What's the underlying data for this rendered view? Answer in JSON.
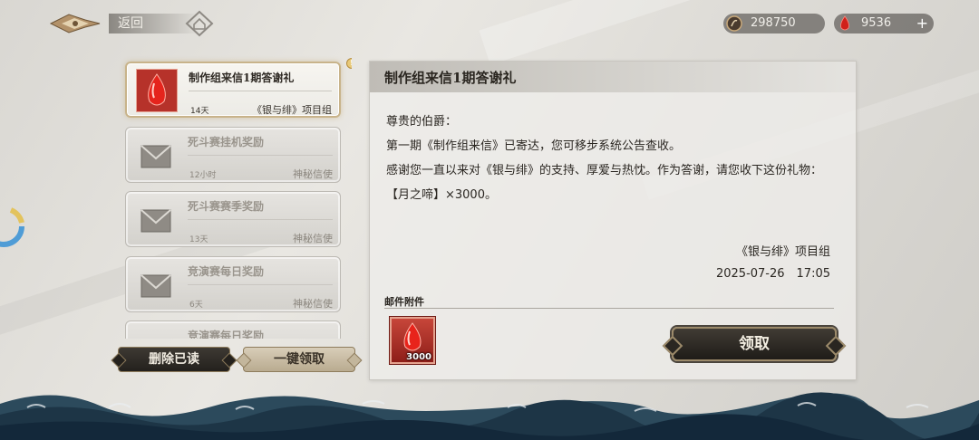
{
  "topbar": {
    "back_label": "返回",
    "currencies": [
      {
        "icon": "silver-coin-icon",
        "value": "298750"
      },
      {
        "icon": "red-crystal-icon",
        "value": "9536",
        "plus": "+"
      }
    ]
  },
  "mail_list": {
    "items": [
      {
        "title": "制作组来信1期答谢礼",
        "days": "14天",
        "sender": "《银与绯》项目组",
        "icon": "red-crystal-icon",
        "selected": true,
        "badge": "!"
      },
      {
        "title": "死斗赛挂机奖励",
        "days": "12小时",
        "sender": "神秘信使",
        "icon": "envelope-icon"
      },
      {
        "title": "死斗赛赛季奖励",
        "days": "13天",
        "sender": "神秘信使",
        "icon": "envelope-icon"
      },
      {
        "title": "竞演赛每日奖励",
        "days": "6天",
        "sender": "神秘信使",
        "icon": "envelope-icon"
      },
      {
        "title": "竞演赛每日奖励",
        "days": "",
        "sender": "",
        "icon": "envelope-icon"
      }
    ],
    "delete_read_label": "删除已读",
    "collect_all_label": "一键领取"
  },
  "detail": {
    "title": "制作组来信1期答谢礼",
    "body": [
      "尊贵的伯爵：",
      "第一期《制作组来信》已寄达，您可移步系统公告查收。",
      "感谢您一直以来对《银与绯》的支持、厚爱与热忱。作为答谢，请您收下这份礼物：",
      "【月之啼】×3000。"
    ],
    "signature": "《银与绯》项目组",
    "date": "2025-07-26　17:05",
    "attachment_label": "邮件附件",
    "attachment": {
      "icon": "red-crystal-icon",
      "count": "3000"
    },
    "claim_label": "领取"
  },
  "colors": {
    "accent_gold": "#c8b38a",
    "crystal_red": "#c8241c",
    "button_dark": "#2a2621"
  }
}
